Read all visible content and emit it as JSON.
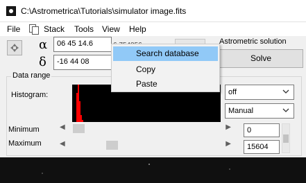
{
  "window": {
    "title": "C:\\Astrometrica\\Tutorials\\simulator image.fits",
    "app_icon": "astrometrica-app-icon"
  },
  "menubar": {
    "items": [
      "File",
      "Stack",
      "Tools",
      "View",
      "Help"
    ],
    "copy_icon": "copy-icon"
  },
  "coordinates": {
    "alpha_symbol": "α",
    "delta_symbol": "δ",
    "ra_value": "06 45 14.6",
    "dec_value": "-16 44 08",
    "partial_value": "6.754856"
  },
  "astrometric": {
    "label": "Astrometric solution",
    "solve_label": "Solve"
  },
  "data_range": {
    "group_label": "Data range",
    "histogram_label": "Histogram:",
    "stretch_select": "off",
    "mode_select": "Manual",
    "minimum_label": "Minimum",
    "maximum_label": "Maximum",
    "minimum_value": "0",
    "maximum_value": "15604",
    "minimum_slider_position": 0.04,
    "maximum_slider_position": 0.27
  },
  "context_menu": {
    "items": [
      {
        "label": "Search database",
        "active": true
      },
      {
        "label": "Copy",
        "active": false
      },
      {
        "label": "Paste",
        "active": false
      }
    ]
  },
  "colors": {
    "menu_highlight": "#91c9f7",
    "histogram_bg": "#000000",
    "histogram_bar": "#ff0000"
  }
}
